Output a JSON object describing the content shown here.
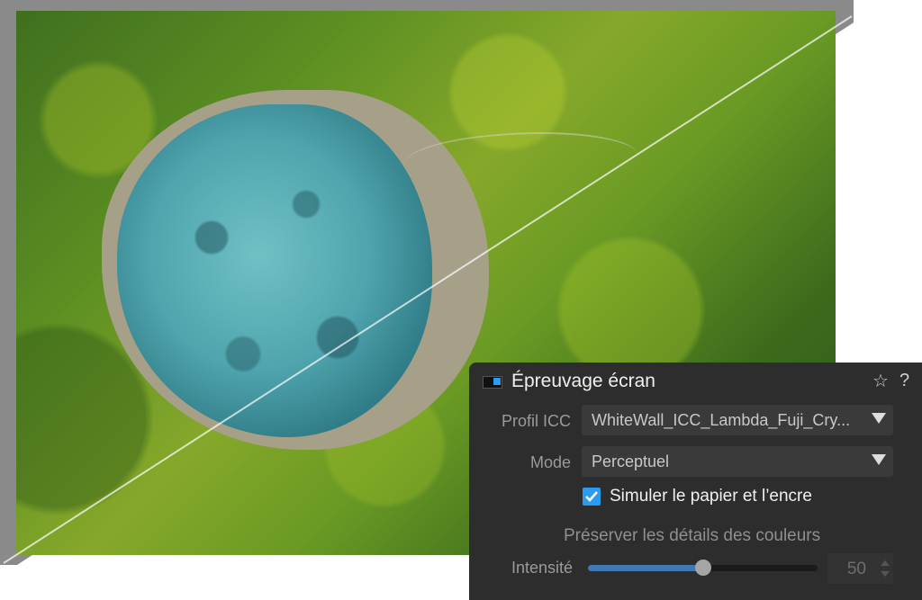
{
  "panel": {
    "title": "Épreuvage écran",
    "icons": {
      "preview": "split-preview-icon",
      "star": "star-icon",
      "help": "help-icon"
    },
    "profile": {
      "label": "Profil ICC",
      "value": "WhiteWall_ICC_Lambda_Fuji_Cry..."
    },
    "mode": {
      "label": "Mode",
      "value": "Perceptuel"
    },
    "simulate": {
      "label": "Simuler le papier et l’encre",
      "checked": true
    },
    "preserve_label": "Préserver les détails des couleurs",
    "intensity": {
      "label": "Intensité",
      "value": "50",
      "fraction": 0.5
    }
  },
  "colors": {
    "accent": "#2b9bf0",
    "panel_bg": "#2d2d2d"
  }
}
